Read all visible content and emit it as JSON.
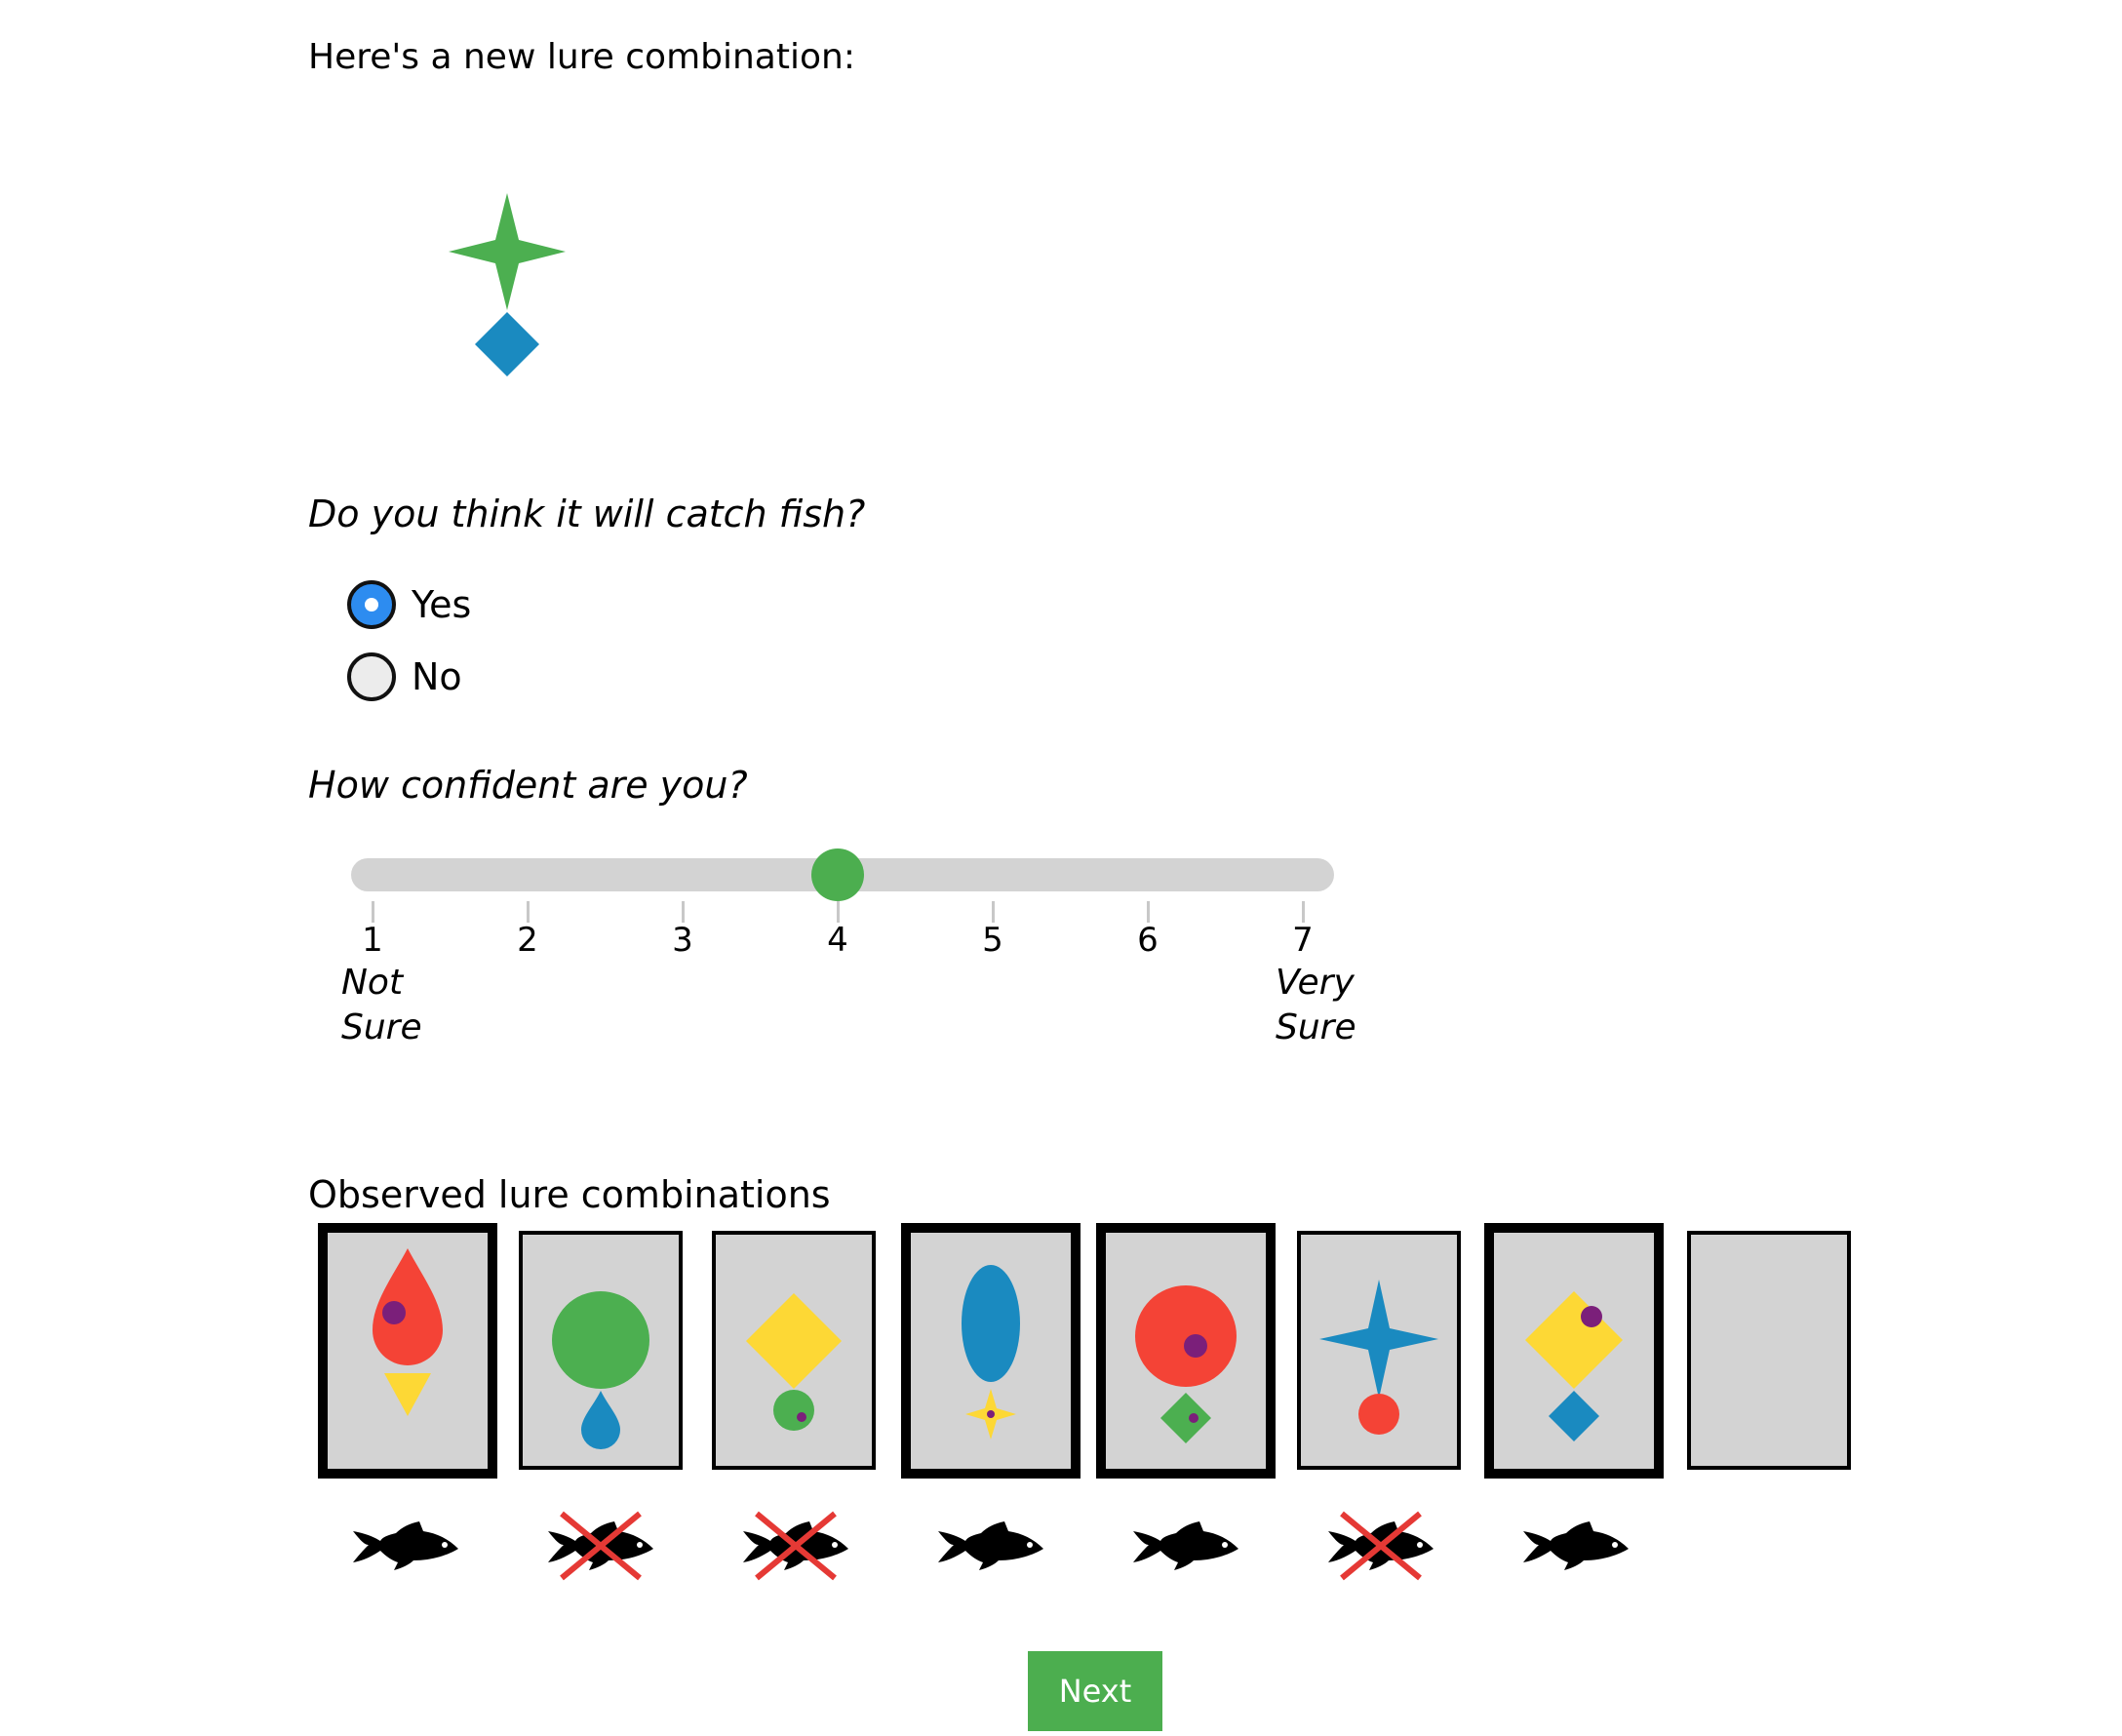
{
  "intro_text": "Here's a new lure combination:",
  "new_lure": {
    "top": "four-point-star",
    "top_color": "#4caf50",
    "bottom": "diamond",
    "bottom_color": "#1a8ac0"
  },
  "question_catch": "Do you think it will catch fish?",
  "answers": [
    {
      "label": "Yes",
      "selected": true
    },
    {
      "label": "No",
      "selected": false
    }
  ],
  "question_confidence": "How confident are you?",
  "confidence": {
    "value": 4,
    "min": 1,
    "max": 7,
    "ticks": [
      "1",
      "2",
      "3",
      "4",
      "5",
      "6",
      "7"
    ],
    "low_label": [
      "Not",
      "Sure"
    ],
    "high_label": [
      "Very",
      "Sure"
    ]
  },
  "observed_title": "Observed lure combinations",
  "observed": [
    {
      "top": "teardrop",
      "top_color": "red",
      "dot": true,
      "bottom": "triangle",
      "bottom_color": "yellow",
      "caught_fish": true
    },
    {
      "top": "circle",
      "top_color": "green",
      "dot": false,
      "bottom": "teardrop",
      "bottom_color": "blue",
      "caught_fish": false
    },
    {
      "top": "diamond",
      "top_color": "yellow",
      "dot": false,
      "bottom": "circle",
      "bottom_color": "green",
      "caught_fish": false
    },
    {
      "top": "ellipse",
      "top_color": "blue",
      "dot": false,
      "bottom": "four-point-star",
      "bottom_color": "yellow",
      "caught_fish": true
    },
    {
      "top": "circle",
      "top_color": "red",
      "dot": true,
      "bottom": "diamond",
      "bottom_color": "green",
      "caught_fish": true
    },
    {
      "top": "four-point-star",
      "top_color": "blue",
      "dot": false,
      "bottom": "circle",
      "bottom_color": "red",
      "caught_fish": false
    },
    {
      "top": "diamond",
      "top_color": "yellow",
      "dot": true,
      "bottom": "diamond",
      "bottom_color": "blue",
      "caught_fish": true
    },
    {
      "empty": true
    }
  ],
  "colors": {
    "red": "#f44336",
    "green": "#4caf50",
    "blue": "#1a8ac0",
    "yellow": "#fdd835",
    "purple": "#7b1f7a",
    "card_bg": "#d3d3d3",
    "accent_green": "#4cae4f",
    "radio_blue": "#2d8cf0",
    "cross_red": "#e53935"
  },
  "icons": {
    "fish": "fish-icon",
    "no_fish": "fish-crossed-icon"
  },
  "next_label": "Next"
}
